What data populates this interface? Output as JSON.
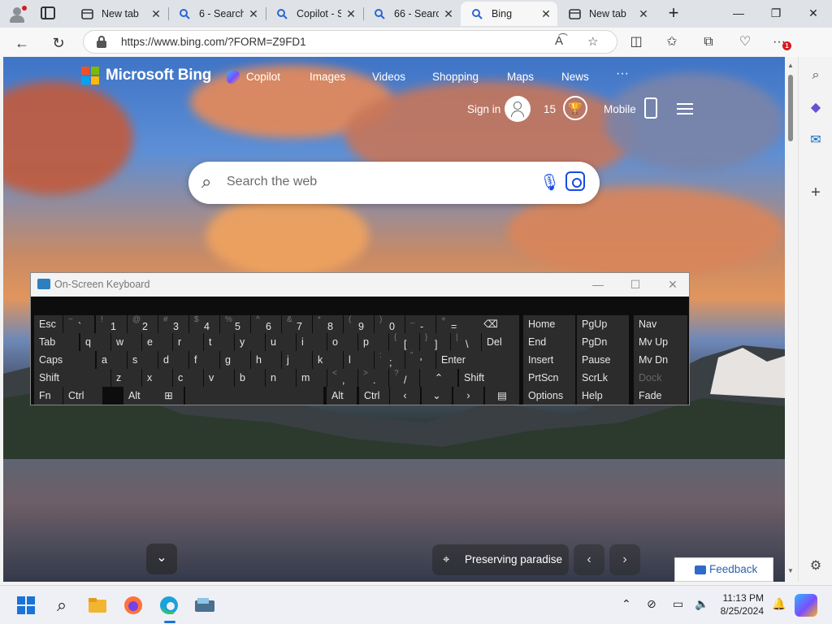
{
  "browser": {
    "tabs": [
      {
        "label": "New tab",
        "favicon": "newtab-icon",
        "active": false
      },
      {
        "label": "6 - Search",
        "favicon": "bing-search-icon",
        "active": false
      },
      {
        "label": "Copilot - S",
        "favicon": "bing-search-icon",
        "active": false
      },
      {
        "label": "66 - Searc",
        "favicon": "bing-search-icon",
        "active": false
      },
      {
        "label": "Bing",
        "favicon": "bing-search-icon",
        "active": true
      },
      {
        "label": "New tab",
        "favicon": "newtab-icon",
        "active": false
      }
    ],
    "url": "https://www.bing.com/?FORM=Z9FD1",
    "notification_count": "1"
  },
  "bing": {
    "brand": "Microsoft Bing",
    "nav": [
      "Copilot",
      "Images",
      "Videos",
      "Shopping",
      "Maps",
      "News"
    ],
    "more": "···",
    "sign_in": "Sign in",
    "points": "15",
    "mobile": "Mobile",
    "search_placeholder": "Search the web",
    "caption": "Preserving paradise",
    "feedback": "Feedback"
  },
  "keyboard": {
    "title": "On-Screen Keyboard",
    "rows": {
      "r1": [
        "Esc",
        "~ `",
        "! 1",
        "@ 2",
        "# 3",
        "$ 4",
        "% 5",
        "^ 6",
        "& 7",
        "* 8",
        "( 9",
        ") 0",
        "_ -",
        "+ ="
      ],
      "r2": [
        "Tab",
        "q",
        "w",
        "e",
        "r",
        "t",
        "y",
        "u",
        "i",
        "o",
        "p",
        "{ [",
        "} ]",
        "| \\",
        "Del"
      ],
      "r3": [
        "Caps",
        "a",
        "s",
        "d",
        "f",
        "g",
        "h",
        "j",
        "k",
        "l",
        ": ;",
        "\" '",
        "Enter"
      ],
      "r4": [
        "Shift",
        "z",
        "x",
        "c",
        "v",
        "b",
        "n",
        "m",
        "< ,",
        "> .",
        "? /",
        "Shift"
      ],
      "r5": [
        "Fn",
        "Ctrl",
        "Alt",
        "Alt",
        "Ctrl"
      ]
    },
    "nav_keys": {
      "c1": [
        "Home",
        "End",
        "Insert",
        "PrtScn",
        "Options"
      ],
      "c2": [
        "PgUp",
        "PgDn",
        "Pause",
        "ScrLk",
        "Help"
      ],
      "c3": [
        "Nav",
        "Mv Up",
        "Mv Dn",
        "Dock",
        "Fade"
      ]
    }
  },
  "taskbar": {
    "time": "11:13 PM",
    "date": "8/25/2024"
  }
}
